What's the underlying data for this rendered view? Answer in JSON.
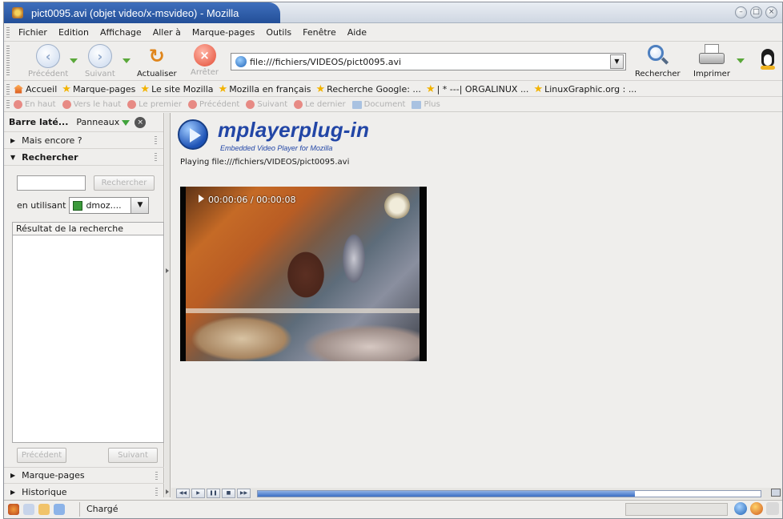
{
  "window": {
    "title": "pict0095.avi (objet video/x-msvideo) - Mozilla"
  },
  "menu": {
    "items": [
      "Fichier",
      "Edition",
      "Affichage",
      "Aller à",
      "Marque-pages",
      "Outils",
      "Fenêtre",
      "Aide"
    ]
  },
  "nav": {
    "back_label": "Précédent",
    "forward_label": "Suivant",
    "reload_label": "Actualiser",
    "stop_label": "Arrêter",
    "url": "file:///fichiers/VIDEOS/pict0095.avi",
    "search_label": "Rechercher",
    "print_label": "Imprimer"
  },
  "bookmarks": {
    "items": [
      {
        "label": "Accueil",
        "icon": "home-icon"
      },
      {
        "label": "Marque-pages",
        "icon": "bookmarks-icon"
      },
      {
        "label": "Le site Mozilla",
        "icon": "star-icon"
      },
      {
        "label": "Mozilla en français",
        "icon": "star-icon"
      },
      {
        "label": "Recherche Google: ...",
        "icon": "star-icon"
      },
      {
        "label": "| * ---| ORGALINUX ...",
        "icon": "star-icon"
      },
      {
        "label": "LinuxGraphic.org : ...",
        "icon": "star-icon"
      }
    ]
  },
  "sitenav": {
    "items": [
      "En haut",
      "Vers le haut",
      "Le premier",
      "Précédent",
      "Suivant",
      "Le dernier",
      "Document",
      "Plus"
    ]
  },
  "sidebar": {
    "title": "Barre laté...",
    "panels_label": "Panneaux",
    "more_label": "Mais encore ?",
    "search_section": "Rechercher",
    "search_button": "Rechercher",
    "engine_prefix": "en utilisant",
    "engine_value": "dmoz....",
    "results_header": "Résultat de la recherche",
    "prev_button": "Précédent",
    "next_button": "Suivant",
    "bookmarks_section": "Marque-pages",
    "history_section": "Historique"
  },
  "content": {
    "plugin_title": "mplayerplug-in",
    "plugin_subtitle": "Embedded Video Player for Mozilla",
    "playing_text": "Playing file:///fichiers/VIDEOS/pict0095.avi",
    "video_time": "00:00:06 / 00:00:08"
  },
  "player": {
    "progress_fraction": 0.75
  },
  "status": {
    "text": "Chargé"
  },
  "colors": {
    "title_bar": "#2a57a4",
    "plugin_blue": "#2246a6",
    "progress_blue": "#3b6fc4"
  }
}
